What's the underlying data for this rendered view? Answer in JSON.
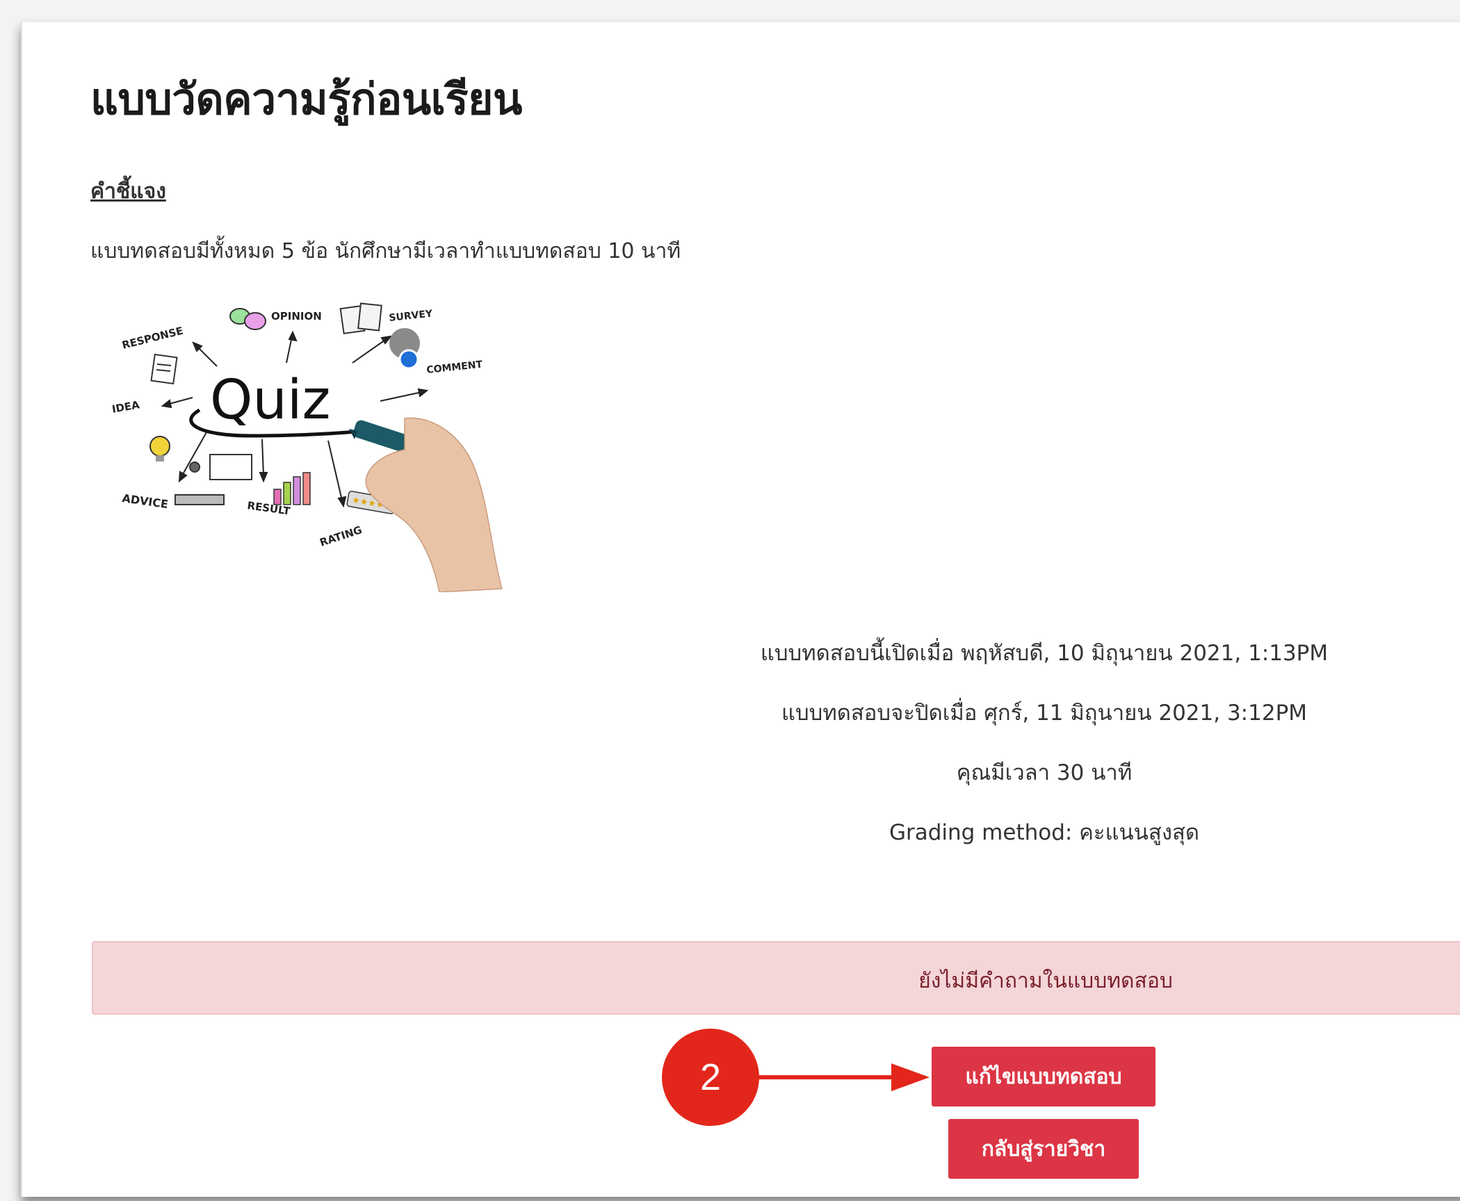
{
  "page": {
    "title": "แบบวัดความรู้ก่อนเรียน",
    "subheading": "คำชี้แจง",
    "description": "แบบทดสอบมีทั้งหมด 5 ข้อ นักศึกษามีเวลาทำแบบทดสอบ 10 นาที"
  },
  "image": {
    "main_word": "Quiz",
    "labels": {
      "response": "RESPONSE",
      "opinion": "OPINION",
      "survey": "SURVEY",
      "comment": "COMMENT",
      "idea": "IDEA",
      "advice": "ADVICE",
      "result": "RESULT",
      "rating": "RATING"
    }
  },
  "quiz_info": {
    "opened": "แบบทดสอบนี้เปิดเมื่อ พฤหัสบดี, 10 มิถุนายน 2021, 1:13PM",
    "closes": "แบบทดสอบจะปิดเมื่อ ศุกร์, 11 มิถุนายน 2021, 3:12PM",
    "time_limit": "คุณมีเวลา 30 นาที",
    "grading": "Grading method: คะแนนสูงสุด"
  },
  "alert": {
    "text": "ยังไม่มีคำถามในแบบทดสอบ"
  },
  "buttons": {
    "edit_quiz": "แก้ไขแบบทดสอบ",
    "back_to_course": "กลับสู่รายวิชา"
  },
  "annotation": {
    "step_number": "2"
  },
  "colors": {
    "button_bg": "#dc3545",
    "alert_bg": "#f4d6d8",
    "alert_text": "#7a1f2b",
    "annotation_red": "#e3261b"
  }
}
